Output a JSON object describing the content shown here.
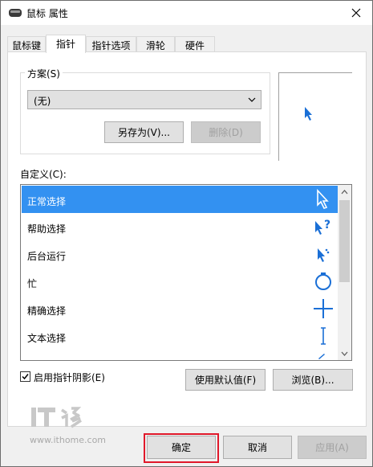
{
  "window": {
    "title": "鼠标 属性"
  },
  "tabs": [
    {
      "label": "鼠标键"
    },
    {
      "label": "指针"
    },
    {
      "label": "指针选项"
    },
    {
      "label": "滑轮"
    },
    {
      "label": "硬件"
    }
  ],
  "scheme": {
    "label": "方案(S)",
    "selected": "(无)",
    "save_as_label": "另存为(V)...",
    "delete_label": "删除(D)"
  },
  "customize": {
    "label": "自定义(C):",
    "items": [
      {
        "label": "正常选择",
        "icon": "arrow-cursor-icon"
      },
      {
        "label": "帮助选择",
        "icon": "help-cursor-icon"
      },
      {
        "label": "后台运行",
        "icon": "working-cursor-icon"
      },
      {
        "label": "忙",
        "icon": "busy-cursor-icon"
      },
      {
        "label": "精确选择",
        "icon": "crosshair-cursor-icon"
      },
      {
        "label": "文本选择",
        "icon": "text-cursor-icon"
      }
    ]
  },
  "shadow": {
    "label": "启用指针阴影(E)",
    "checked": true
  },
  "use_default_label": "使用默认值(F)",
  "browse_label": "浏览(B)...",
  "watermark": {
    "url": "www.ithome.com"
  },
  "footer": {
    "ok_label": "确定",
    "cancel_label": "取消",
    "apply_label": "应用(A)"
  },
  "colors": {
    "accent": "#3391f1",
    "cursor_blue": "#1a6fd6",
    "highlight_red": "#e0182a"
  }
}
